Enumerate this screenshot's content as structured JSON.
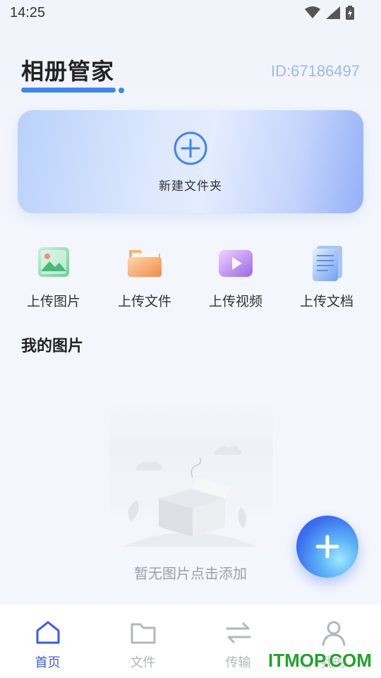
{
  "status_bar": {
    "time": "14:25"
  },
  "header": {
    "title": "相册管家",
    "user_id": "ID:67186497"
  },
  "new_folder": {
    "label": "新建文件夹"
  },
  "upload_actions": [
    {
      "label": "上传图片",
      "icon": "image-icon"
    },
    {
      "label": "上传文件",
      "icon": "folder-icon"
    },
    {
      "label": "上传视频",
      "icon": "video-icon"
    },
    {
      "label": "上传文档",
      "icon": "document-icon"
    }
  ],
  "my_pictures": {
    "title": "我的图片",
    "empty_text": "暂无图片点击添加"
  },
  "bottom_nav": [
    {
      "label": "首页",
      "icon": "home-icon",
      "active": true
    },
    {
      "label": "文件",
      "icon": "folder-icon",
      "active": false
    },
    {
      "label": "传输",
      "icon": "transfer-icon",
      "active": false
    },
    {
      "label": "我的",
      "icon": "user-icon",
      "active": false
    }
  ],
  "watermark": "ITMOP.COM",
  "colors": {
    "accent": "#3f84f3",
    "nav_active": "#3a5be8",
    "fab": "#3c6ff0"
  }
}
